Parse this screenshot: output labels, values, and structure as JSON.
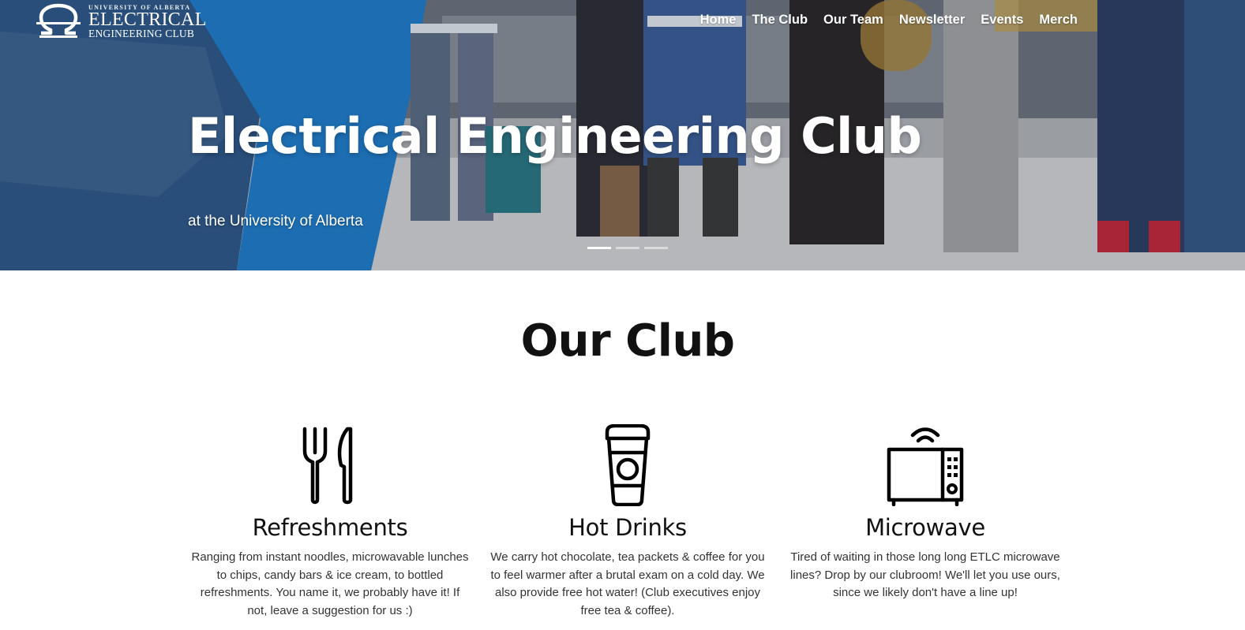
{
  "logo": {
    "small_text": "UNIVERSITY OF ALBERTA",
    "main_text": "ELECTRICAL",
    "sub_text": "ENGINEERING CLUB"
  },
  "nav": {
    "items": [
      "Home",
      "The Club",
      "Our Team",
      "Newsletter",
      "Events",
      "Merch"
    ]
  },
  "hero": {
    "title": "Electrical Engineering Club",
    "subtitle": "at the University of Alberta",
    "slides": 3,
    "active_slide": 1
  },
  "club": {
    "title": "Our Club",
    "features": [
      {
        "icon": "cutlery-icon",
        "title": "Refreshments",
        "description": "Ranging from instant noodles, microwavable lunches to chips, candy bars & ice cream, to bottled refreshments. You name it, we probably have it! If not, leave a suggestion for us :)"
      },
      {
        "icon": "coffee-cup-icon",
        "title": "Hot Drinks",
        "description": "We carry hot chocolate, tea packets & coffee for you to feel warmer after a brutal exam on a cold day. We also provide free hot water! (Club executives enjoy free tea & coffee)."
      },
      {
        "icon": "microwave-icon",
        "title": "Microwave",
        "description": "Tired of waiting in those long long ETLC microwave lines? Drop by our clubroom! We'll let you use ours, since we likely don't have a line up!"
      }
    ]
  },
  "colors": {
    "hero_text": "#ffffff",
    "body_text": "#333333",
    "heading": "#111111"
  }
}
